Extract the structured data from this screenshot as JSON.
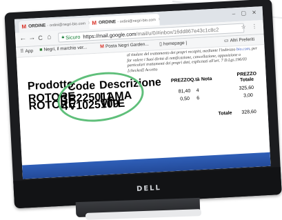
{
  "browser": {
    "tabs": [
      {
        "title": "ORDINE",
        "subtitle": "- ordini@negri-bio.com",
        "close": "×",
        "active": false
      },
      {
        "title": "ORDINE",
        "subtitle": "- ordini@negri-bio.com",
        "close": "×",
        "active": true
      }
    ],
    "nav": {
      "back": "←",
      "forward": "→",
      "reload": "C",
      "home": "⌂"
    },
    "address": {
      "secure_label": "Sicuro",
      "url_main": "https://mail.google.com",
      "url_rest": "/mail/u/0/#inbox/16dd867e43c1c8c2"
    },
    "bookmarks": [
      {
        "label": "App",
        "icon": "apps-grid-icon"
      },
      {
        "label": "Negri, il marchio ver...",
        "icon": "leaf-icon"
      },
      {
        "label": "Posta Negri Garden...",
        "icon": "gmail-icon"
      },
      {
        "label": "homepage |",
        "icon": "page-icon"
      },
      {
        "label": "Altri Preferiti",
        "icon": "folder-icon"
      }
    ]
  },
  "email": {
    "disclaimer": [
      "al titolare del trattamento dei propri recapiti, mediante l'indirizzo ",
      "bio.com",
      ", per far valere i Suoi diritti di rettificazione, cancellazione, opposizione o",
      "particolari trattamenti dei propri dati, esplicitati all'art. 7 D.Lgs.196/03",
      "[checked] Accetto"
    ],
    "order_table": {
      "headers": [
        "Prodotto",
        "Code",
        "Descrizione"
      ],
      "rows": [
        [
          "ROTORE",
          "3",
          "R225011",
          "LAMA"
        ],
        [
          "ROTORE",
          "4",
          "V1025109",
          "VITE"
        ]
      ]
    },
    "price_table": {
      "headers": [
        "PREZZO",
        "Q.tà",
        "Nota",
        "PREZZO",
        "Totale"
      ],
      "rows": [
        [
          "81,40",
          "4",
          "",
          "325,60"
        ],
        [
          "0,50",
          "6",
          "",
          "3,00"
        ]
      ],
      "total_label": "Totale",
      "total_value": "328,60"
    }
  },
  "device": {
    "brand": "DELL"
  },
  "colors": {
    "gmail_red": "#d93025",
    "secure_green": "#188038",
    "highlight_circle": "#5fbf7a",
    "taskbar_blue": "#2f5fb8",
    "bezel": "#1b1c1f"
  }
}
